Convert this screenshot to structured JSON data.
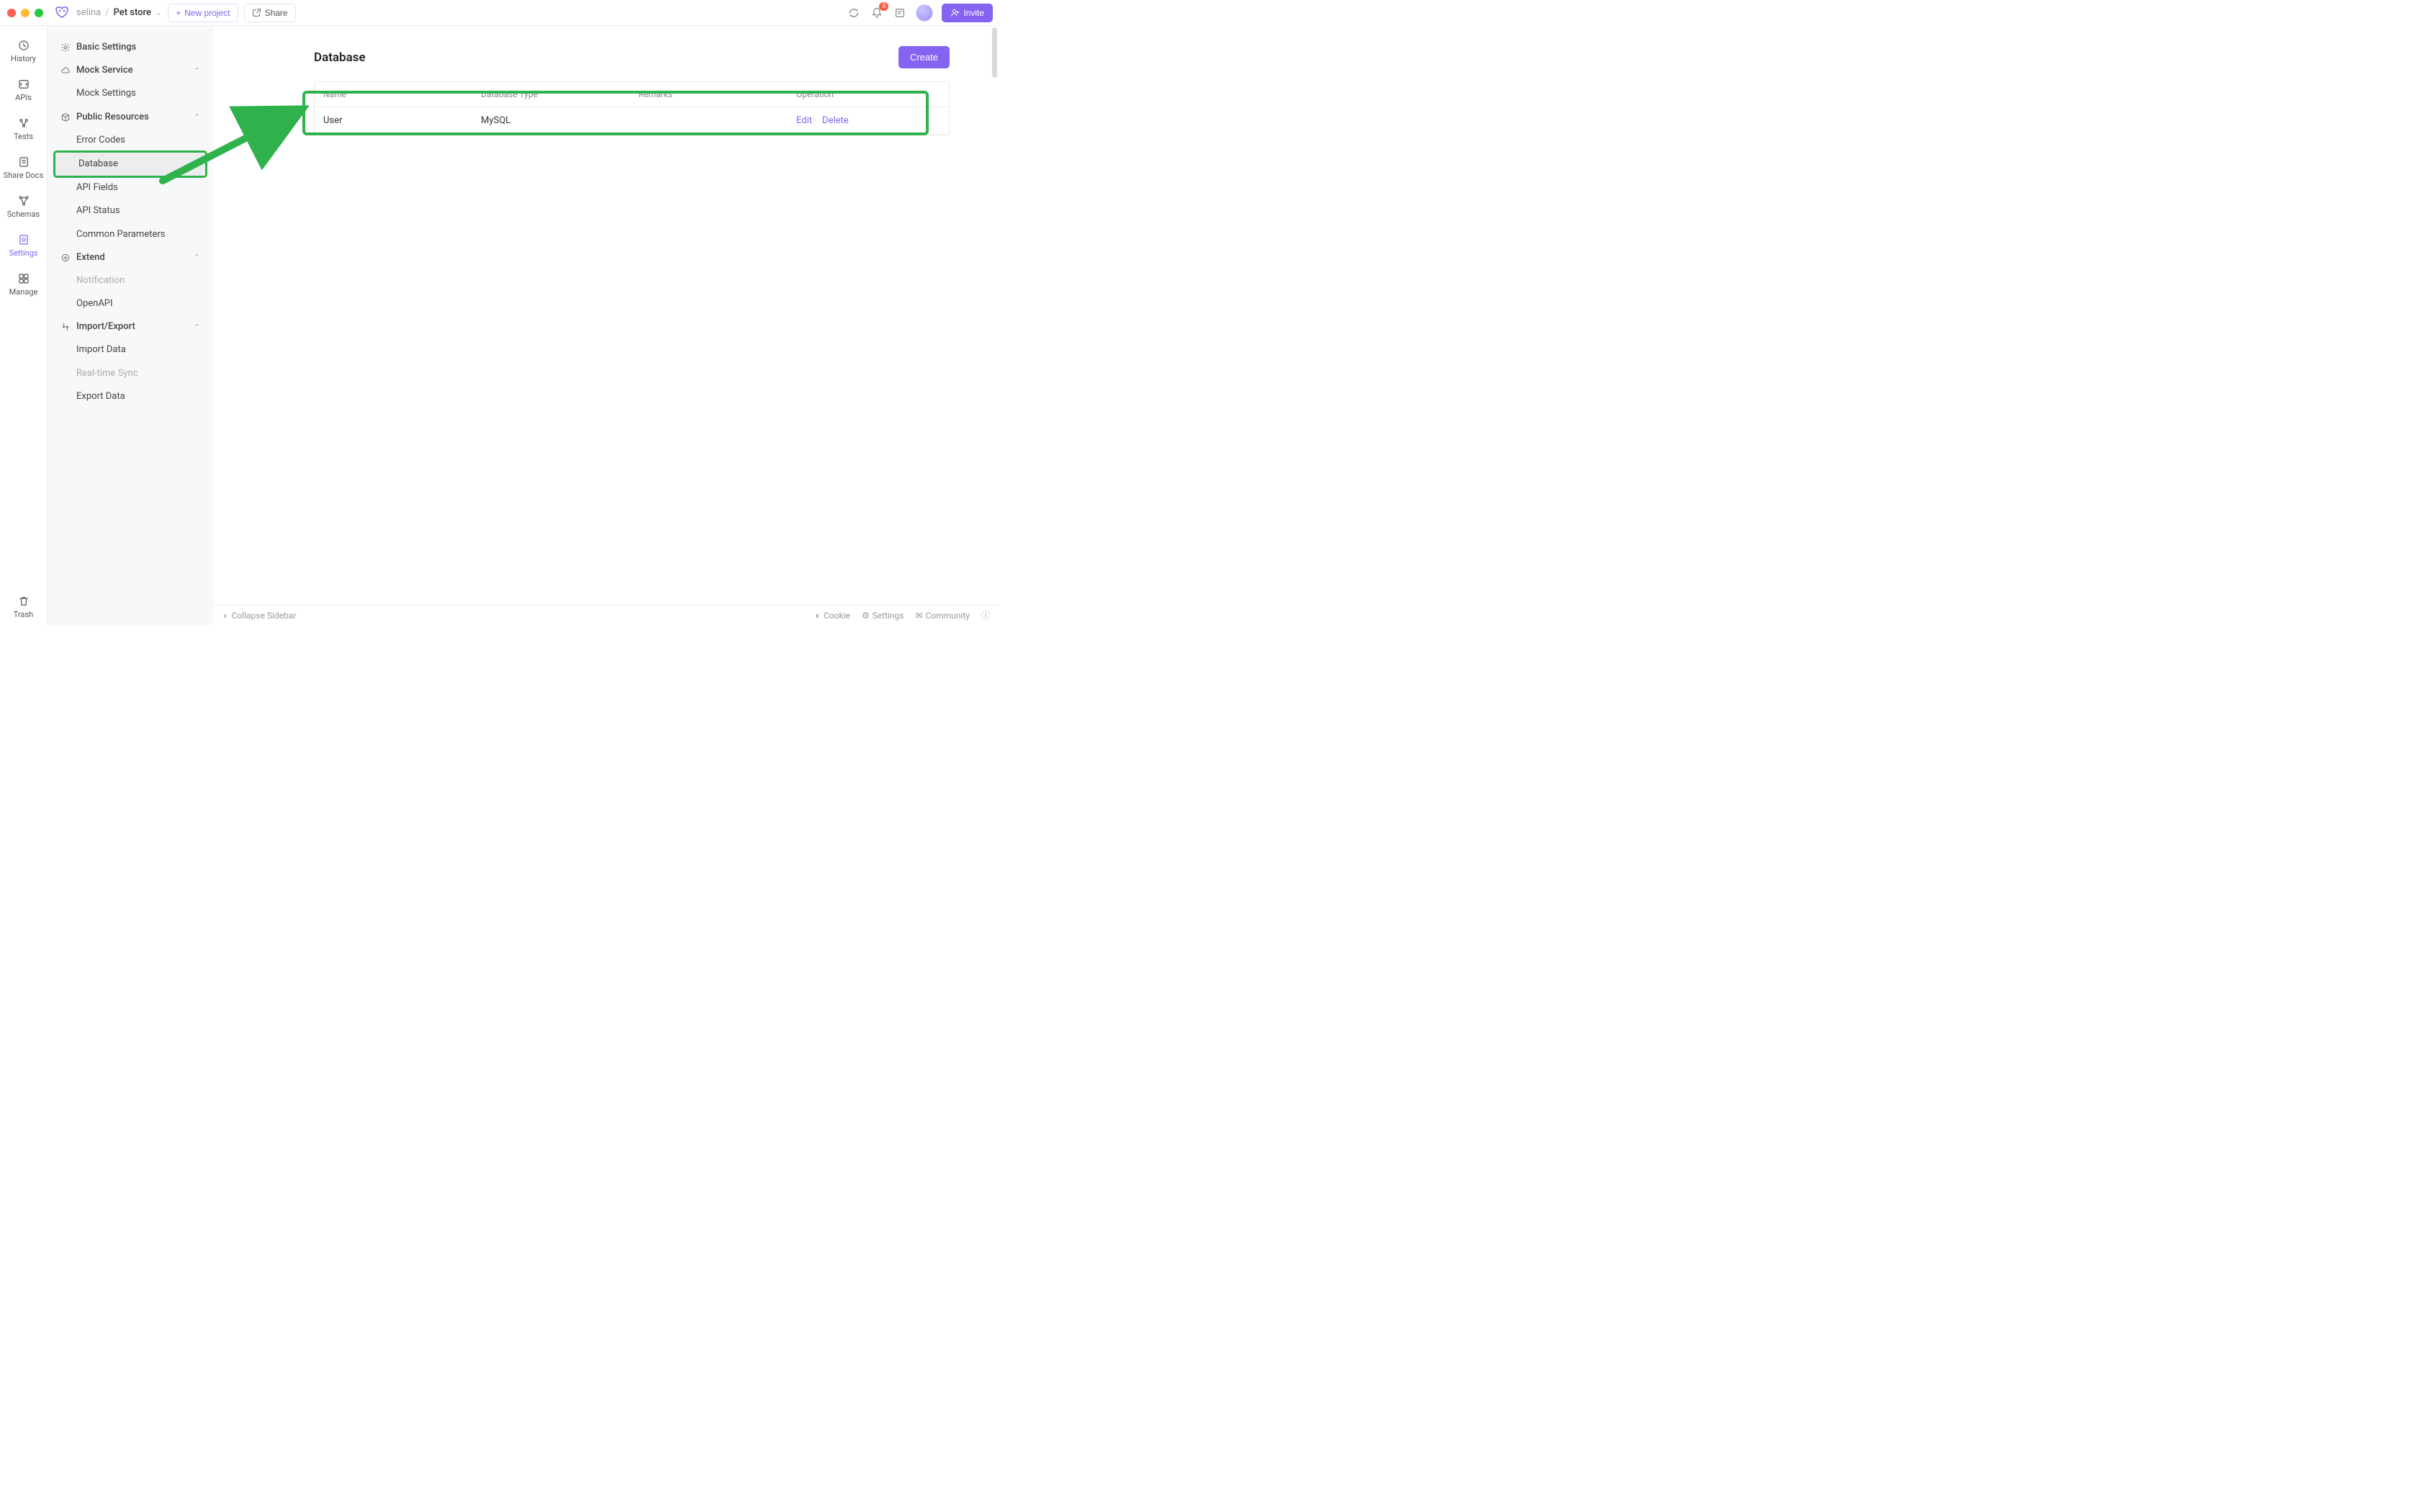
{
  "header": {
    "breadcrumb_user": "selina",
    "breadcrumb_project": "Pet store",
    "new_project_label": "New project",
    "share_label": "Share",
    "invite_label": "Invite",
    "notification_count": "8"
  },
  "rail": {
    "history": "History",
    "apis": "APIs",
    "tests": "Tests",
    "share_docs": "Share Docs",
    "schemas": "Schemas",
    "settings": "Settings",
    "manage": "Manage",
    "trash": "Trash"
  },
  "sidebar": {
    "basic_settings": "Basic Settings",
    "mock_service": "Mock Service",
    "mock_settings": "Mock Settings",
    "public_resources": "Public Resources",
    "error_codes": "Error Codes",
    "database": "Database",
    "api_fields": "API Fields",
    "api_status": "API Status",
    "common_parameters": "Common Parameters",
    "extend": "Extend",
    "notification": "Notification",
    "openapi": "OpenAPI",
    "import_export": "Import/Export",
    "import_data": "Import Data",
    "realtime_sync": "Real-time Sync",
    "export_data": "Export Data"
  },
  "page": {
    "title": "Database",
    "create_label": "Create",
    "columns": {
      "name": "Name",
      "db_type": "Database Type",
      "remarks": "Remarks",
      "operation": "Operation"
    },
    "rows": [
      {
        "name": "User",
        "db_type": "MySQL",
        "remarks": "",
        "edit": "Edit",
        "delete": "Delete"
      }
    ]
  },
  "statusbar": {
    "collapse": "Collapse Sidebar",
    "cookie": "Cookie",
    "settings": "Settings",
    "community": "Community"
  }
}
